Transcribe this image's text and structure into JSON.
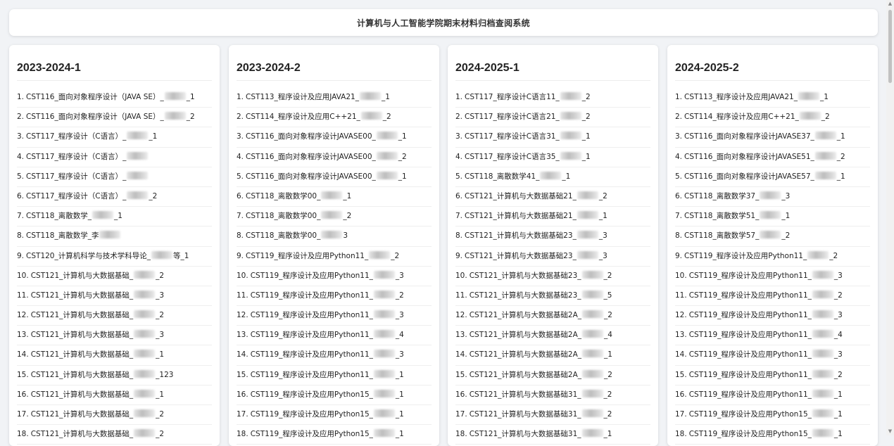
{
  "header": {
    "title": "计算机与人工智能学院期末材料归档查阅系统"
  },
  "columns": [
    {
      "title": "2023-2024-1",
      "items": [
        {
          "num": "1.",
          "pre": "CST116_面向对象程序设计（JAVA SE）_",
          "post": "_1"
        },
        {
          "num": "2.",
          "pre": "CST116_面向对象程序设计（JAVA SE）_",
          "post": "_2"
        },
        {
          "num": "3.",
          "pre": "CST117_程序设计（C语言）_",
          "post": "_1"
        },
        {
          "num": "4.",
          "pre": "CST117_程序设计（C语言）_",
          "post": ""
        },
        {
          "num": "5.",
          "pre": "CST117_程序设计（C语言）_",
          "post": ""
        },
        {
          "num": "6.",
          "pre": "CST117_程序设计（C语言）_",
          "post": "_2"
        },
        {
          "num": "7.",
          "pre": "CST118_离散数学_",
          "post": "_1"
        },
        {
          "num": "8.",
          "pre": "CST118_离散数学_李",
          "post": ""
        },
        {
          "num": "9.",
          "pre": "CST120_计算机科学与技术学科导论_",
          "post": "等_1"
        },
        {
          "num": "10.",
          "pre": "CST121_计算机与大数据基础_",
          "post": "_2"
        },
        {
          "num": "11.",
          "pre": "CST121_计算机与大数据基础_",
          "post": "_3"
        },
        {
          "num": "12.",
          "pre": "CST121_计算机与大数据基础_",
          "post": "_2"
        },
        {
          "num": "13.",
          "pre": "CST121_计算机与大数据基础_",
          "post": "_3"
        },
        {
          "num": "14.",
          "pre": "CST121_计算机与大数据基础_",
          "post": "_1"
        },
        {
          "num": "15.",
          "pre": "CST121_计算机与大数据基础_",
          "post": "_123"
        },
        {
          "num": "16.",
          "pre": "CST121_计算机与大数据基础_",
          "post": "_1"
        },
        {
          "num": "17.",
          "pre": "CST121_计算机与大数据基础_",
          "post": "_2"
        },
        {
          "num": "18.",
          "pre": "CST121_计算机与大数据基础_",
          "post": "_2"
        }
      ]
    },
    {
      "title": "2023-2024-2",
      "items": [
        {
          "num": "1.",
          "pre": "CST113_程序设计及应用JAVA21_",
          "post": "_1"
        },
        {
          "num": "2.",
          "pre": "CST114_程序设计及应用C++21_",
          "post": "_2"
        },
        {
          "num": "3.",
          "pre": "CST116_面向对象程序设计JAVASE00_",
          "post": "_1"
        },
        {
          "num": "4.",
          "pre": "CST116_面向对象程序设计JAVASE00_",
          "post": "_2"
        },
        {
          "num": "5.",
          "pre": "CST116_面向对象程序设计JAVASE00_",
          "post": "_1"
        },
        {
          "num": "6.",
          "pre": "CST118_离散数学00_",
          "post": "_1"
        },
        {
          "num": "7.",
          "pre": "CST118_离散数学00_",
          "post": "_2"
        },
        {
          "num": "8.",
          "pre": "CST118_离散数学00_",
          "post": "3"
        },
        {
          "num": "9.",
          "pre": "CST119_程序设计及应用Python11_",
          "post": "_2"
        },
        {
          "num": "10.",
          "pre": "CST119_程序设计及应用Python11_",
          "post": "_3"
        },
        {
          "num": "11.",
          "pre": "CST119_程序设计及应用Python11_",
          "post": "_2"
        },
        {
          "num": "12.",
          "pre": "CST119_程序设计及应用Python11_",
          "post": "_3"
        },
        {
          "num": "13.",
          "pre": "CST119_程序设计及应用Python11_",
          "post": "_4"
        },
        {
          "num": "14.",
          "pre": "CST119_程序设计及应用Python11_",
          "post": "_3"
        },
        {
          "num": "15.",
          "pre": "CST119_程序设计及应用Python11_",
          "post": "_1"
        },
        {
          "num": "16.",
          "pre": "CST119_程序设计及应用Python15_",
          "post": "_1"
        },
        {
          "num": "17.",
          "pre": "CST119_程序设计及应用Python15_",
          "post": "_1"
        },
        {
          "num": "18.",
          "pre": "CST119_程序设计及应用Python15_",
          "post": "_1"
        }
      ]
    },
    {
      "title": "2024-2025-1",
      "items": [
        {
          "num": "1.",
          "pre": "CST117_程序设计C语言11_",
          "post": "_2"
        },
        {
          "num": "2.",
          "pre": "CST117_程序设计C语言21_",
          "post": "_2"
        },
        {
          "num": "3.",
          "pre": "CST117_程序设计C语言31_",
          "post": "_1"
        },
        {
          "num": "4.",
          "pre": "CST117_程序设计C语言35_",
          "post": "_1"
        },
        {
          "num": "5.",
          "pre": "CST118_离散数学41_",
          "post": "_1"
        },
        {
          "num": "6.",
          "pre": "CST121_计算机与大数据基础21_",
          "post": "_2"
        },
        {
          "num": "7.",
          "pre": "CST121_计算机与大数据基础21_",
          "post": "_1"
        },
        {
          "num": "8.",
          "pre": "CST121_计算机与大数据基础23_",
          "post": "_3"
        },
        {
          "num": "9.",
          "pre": "CST121_计算机与大数据基础23_",
          "post": "_3"
        },
        {
          "num": "10.",
          "pre": "CST121_计算机与大数据基础23_",
          "post": "_2"
        },
        {
          "num": "11.",
          "pre": "CST121_计算机与大数据基础23_",
          "post": "_5"
        },
        {
          "num": "12.",
          "pre": "CST121_计算机与大数据基础2A_",
          "post": "_2"
        },
        {
          "num": "13.",
          "pre": "CST121_计算机与大数据基础2A_",
          "post": "_4"
        },
        {
          "num": "14.",
          "pre": "CST121_计算机与大数据基础2A_",
          "post": "_1"
        },
        {
          "num": "15.",
          "pre": "CST121_计算机与大数据基础2A_",
          "post": "_2"
        },
        {
          "num": "16.",
          "pre": "CST121_计算机与大数据基础31_",
          "post": "_2"
        },
        {
          "num": "17.",
          "pre": "CST121_计算机与大数据基础31_",
          "post": "_2"
        },
        {
          "num": "18.",
          "pre": "CST121_计算机与大数据基础31_",
          "post": "_1"
        }
      ]
    },
    {
      "title": "2024-2025-2",
      "items": [
        {
          "num": "1.",
          "pre": "CST113_程序设计及应用JAVA21_",
          "post": "_1"
        },
        {
          "num": "2.",
          "pre": "CST114_程序设计及应用C++21_",
          "post": "_2"
        },
        {
          "num": "3.",
          "pre": "CST116_面向对象程序设计JAVASE37_",
          "post": "_1"
        },
        {
          "num": "4.",
          "pre": "CST116_面向对象程序设计JAVASE51_",
          "post": "_2"
        },
        {
          "num": "5.",
          "pre": "CST116_面向对象程序设计JAVASE57_",
          "post": "_1"
        },
        {
          "num": "6.",
          "pre": "CST118_离散数学37_",
          "post": "_3"
        },
        {
          "num": "7.",
          "pre": "CST118_离散数学51_",
          "post": "_1"
        },
        {
          "num": "8.",
          "pre": "CST118_离散数学57_",
          "post": "_2"
        },
        {
          "num": "9.",
          "pre": "CST119_程序设计及应用Python11_",
          "post": "_2"
        },
        {
          "num": "10.",
          "pre": "CST119_程序设计及应用Python11_",
          "post": "_3"
        },
        {
          "num": "11.",
          "pre": "CST119_程序设计及应用Python11_",
          "post": "_2"
        },
        {
          "num": "12.",
          "pre": "CST119_程序设计及应用Python11_",
          "post": "_3"
        },
        {
          "num": "13.",
          "pre": "CST119_程序设计及应用Python11_",
          "post": "_4"
        },
        {
          "num": "14.",
          "pre": "CST119_程序设计及应用Python11_",
          "post": "_3"
        },
        {
          "num": "15.",
          "pre": "CST119_程序设计及应用Python11_",
          "post": "_2"
        },
        {
          "num": "16.",
          "pre": "CST119_程序设计及应用Python11_",
          "post": "_1"
        },
        {
          "num": "17.",
          "pre": "CST119_程序设计及应用Python15_",
          "post": "_1"
        },
        {
          "num": "18.",
          "pre": "CST119_程序设计及应用Python15_",
          "post": "_1"
        }
      ]
    }
  ]
}
